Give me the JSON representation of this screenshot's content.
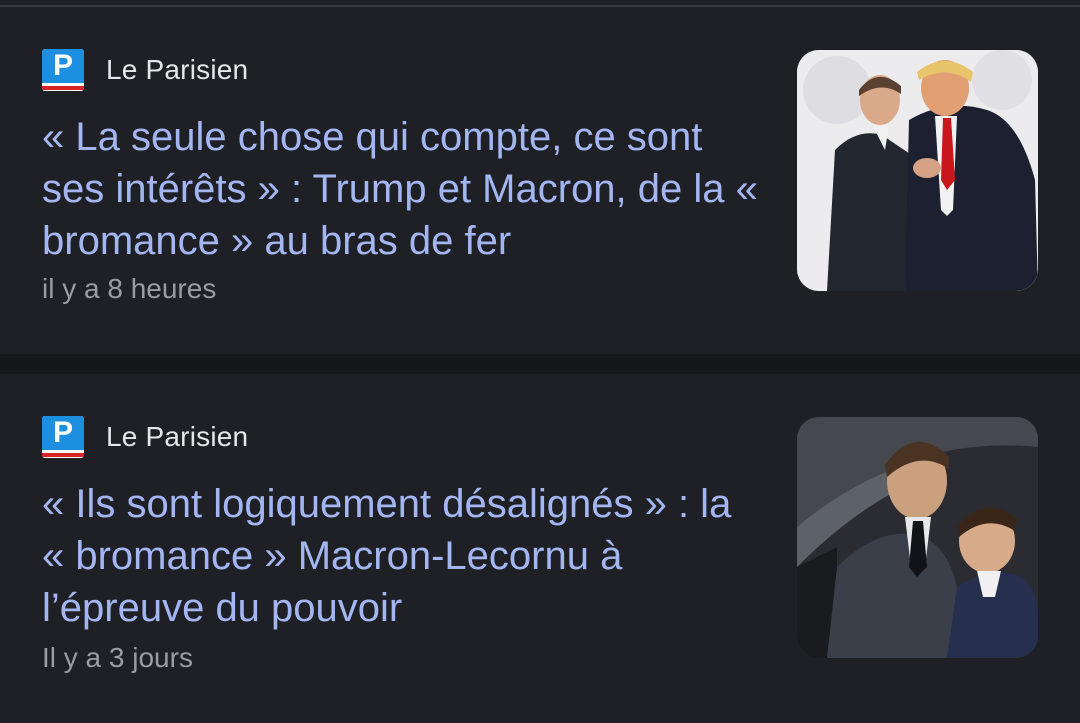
{
  "articles": [
    {
      "source": "Le Parisien",
      "logo_letter": "P",
      "headline": "« La seule chose qui compte, ce sont ses intérêts » : Trump et Macron, de la « bromance » au bras de fer",
      "time": "il y a 8 heures"
    },
    {
      "source": "Le Parisien",
      "logo_letter": "P",
      "headline": "« Ils sont logiquement désalignés » : la « bromance » Macron-Lecornu à l’épreuve du pouvoir",
      "time": "Il y a 3 jours"
    }
  ],
  "colors": {
    "background": "#1f2025",
    "headline": "#a3b6f2",
    "source": "#e6e6ea",
    "timestamp": "#9a9ca4",
    "logo_blue": "#1d8fe1",
    "logo_red": "#d8232a"
  }
}
